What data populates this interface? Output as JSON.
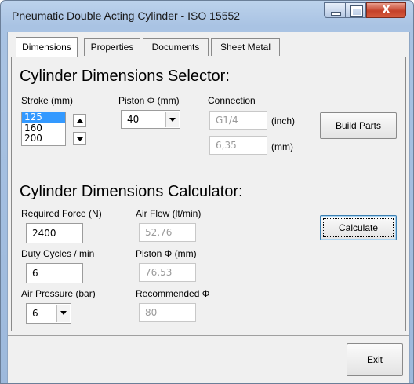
{
  "window": {
    "title": "Pneumatic Double Acting Cylinder - ISO 15552",
    "close_glyph": "X"
  },
  "tabs": [
    {
      "label": "Dimensions",
      "active": true
    },
    {
      "label": "Properties",
      "active": false
    },
    {
      "label": "Documents",
      "active": false
    },
    {
      "label": "Sheet Metal",
      "active": false
    }
  ],
  "selector": {
    "heading": "Cylinder Dimensions Selector:",
    "stroke_label": "Stroke (mm)",
    "stroke_options": [
      "125",
      "160",
      "200"
    ],
    "stroke_selected": "125",
    "piston_label": "Piston Φ (mm)",
    "piston_value": "40",
    "connection_label": "Connection",
    "connection_inch": "G1/4",
    "inch_unit": "(inch)",
    "connection_mm": "6,35",
    "mm_unit": "(mm)",
    "build_label": "Build Parts"
  },
  "calculator": {
    "heading": "Cylinder Dimensions Calculator:",
    "force_label": "Required Force (N)",
    "force_value": "2400",
    "airflow_label": "Air Flow (lt/min)",
    "airflow_value": "52,76",
    "duty_label": "Duty Cycles / min",
    "duty_value": "6",
    "piston_label": "Piston Φ (mm)",
    "piston_value": "76,53",
    "pressure_label": "Air Pressure (bar)",
    "pressure_value": "6",
    "recommended_label": "Recommended Φ",
    "recommended_value": "80",
    "calculate_label": "Calculate"
  },
  "footer": {
    "exit_label": "Exit"
  },
  "colors": {
    "selection": "#3399ff",
    "close_button": "#c4412a",
    "disabled_text": "#9a9a9a"
  }
}
